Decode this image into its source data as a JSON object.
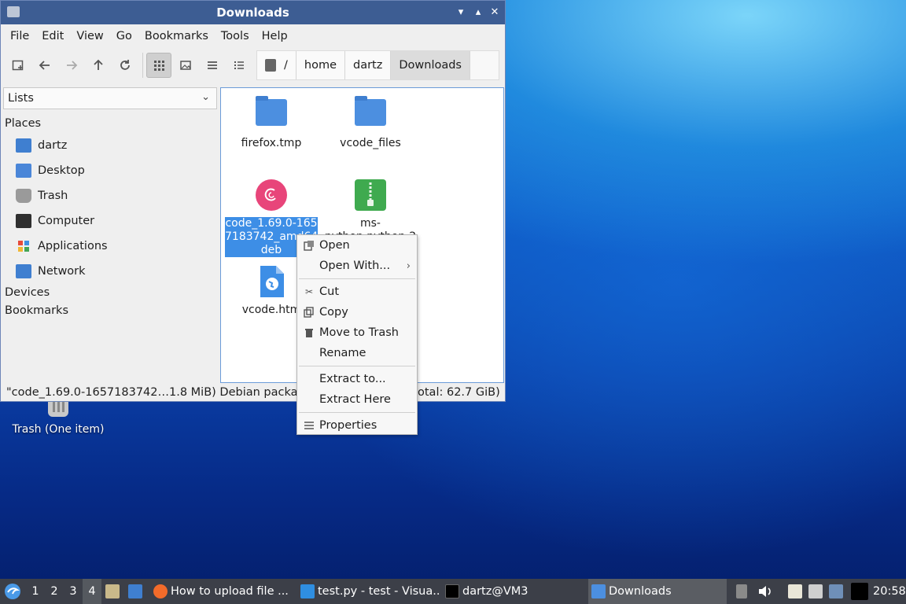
{
  "desktop": {
    "trash_label": "Trash (One item)"
  },
  "window": {
    "title": "Downloads",
    "controls": {
      "minimize": "▾",
      "maximize": "▴",
      "close": "✕"
    },
    "menu": [
      "File",
      "Edit",
      "View",
      "Go",
      "Bookmarks",
      "Tools",
      "Help"
    ],
    "path": {
      "root": "/",
      "crumbs": [
        "home",
        "dartz",
        "Downloads"
      ]
    },
    "sidebar": {
      "select_value": "Lists",
      "places_label": "Places",
      "places": [
        {
          "label": "dartz",
          "icon": "home-folder-icon"
        },
        {
          "label": "Desktop",
          "icon": "desktop-icon"
        },
        {
          "label": "Trash",
          "icon": "trash-icon"
        },
        {
          "label": "Computer",
          "icon": "computer-icon"
        },
        {
          "label": "Applications",
          "icon": "applications-icon"
        },
        {
          "label": "Network",
          "icon": "network-icon"
        }
      ],
      "devices_label": "Devices",
      "bookmarks_label": "Bookmarks"
    },
    "files": [
      {
        "name": "firefox.tmp",
        "type": "folder"
      },
      {
        "name": "vcode_files",
        "type": "folder"
      },
      {
        "name": "code_1.69.0-1657183742_amd64.deb",
        "display_lines": [
          "code_1.69.0-165",
          "7183742_amd64.",
          "deb"
        ],
        "type": "debian-package",
        "selected": true
      },
      {
        "name": "ms-python.python-2",
        "display_lines": [
          "ms-",
          "python.python-2"
        ],
        "type": "archive"
      },
      {
        "name": "vcode.html",
        "display_lines": [
          "vcode.htm"
        ],
        "type": "html"
      }
    ],
    "status_left": "\"code_1.69.0-1657183742…1.8 MiB) Debian package",
    "status_right": "otal: 62.7 GiB)"
  },
  "context_menu": {
    "items": [
      {
        "label": "Open",
        "icon": "open-icon"
      },
      {
        "label": "Open With...",
        "icon": "",
        "submenu": true
      },
      {
        "label": "Cut",
        "icon": "scissors-icon"
      },
      {
        "label": "Copy",
        "icon": "copy-icon"
      },
      {
        "label": "Move to Trash",
        "icon": "trash-icon"
      },
      {
        "label": "Rename",
        "icon": ""
      },
      {
        "label": "Extract to...",
        "icon": ""
      },
      {
        "label": "Extract Here",
        "icon": ""
      },
      {
        "label": "Properties",
        "icon": "properties-icon"
      }
    ]
  },
  "taskbar": {
    "desktops": [
      "1",
      "2",
      "3",
      "4"
    ],
    "active_desktop": "4",
    "tasks": [
      {
        "label": "How to upload file ...",
        "icon": "firefox-icon"
      },
      {
        "label": "test.py - test - Visua...",
        "icon": "vscode-icon"
      },
      {
        "label": "dartz@VM3",
        "icon": "terminal-icon"
      },
      {
        "label": "Downloads",
        "icon": "folder-icon",
        "active": true
      }
    ],
    "clock": "20:58"
  },
  "colors": {
    "titlebar": "#3d5d93",
    "selection": "#3d8ee6",
    "folder": "#4c8fe0",
    "taskbar": "#3c3f48"
  }
}
